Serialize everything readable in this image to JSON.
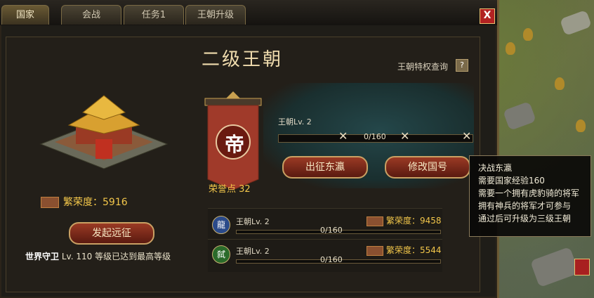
{
  "tabs": [
    {
      "label": "国家",
      "active": true
    },
    {
      "label": "会战",
      "active": false
    },
    {
      "label": "任务1",
      "active": false
    },
    {
      "label": "王朝升级",
      "active": false
    }
  ],
  "close_label": "X",
  "title": "二级王朝",
  "privilege_query": "王朝特权查询",
  "help_label": "?",
  "prosperity": "繁荣度：5916",
  "launch_expedition": "发起远征",
  "world_guard": {
    "name": "世界守卫",
    "level": "Lv. 110",
    "status": "等级已达到最高等级"
  },
  "banner_char": "帝",
  "glory_points": "荣誉点 32",
  "dynasty_level": "王朝Lv. 2",
  "main_progress": {
    "text": "0/160",
    "fraction": 0
  },
  "expedition_east": "出征东瀛",
  "rename_country": "修改国号",
  "rows": [
    {
      "badge": "龍",
      "badge_color": "#2a4a8a",
      "level": "王朝Lv. 2",
      "progress": "0/160",
      "prosperity": "繁荣度：9458"
    },
    {
      "badge": "弑",
      "badge_color": "#2a6a2a",
      "level": "王朝Lv. 2",
      "progress": "0/160",
      "prosperity": "繁荣度：5544"
    }
  ],
  "tooltip": [
    "决战东瀛",
    "需要国家经验160",
    "需要一个拥有虎豹骑的将军",
    "拥有神兵的将军才可参与",
    "通过后可升级为三级王朝"
  ]
}
